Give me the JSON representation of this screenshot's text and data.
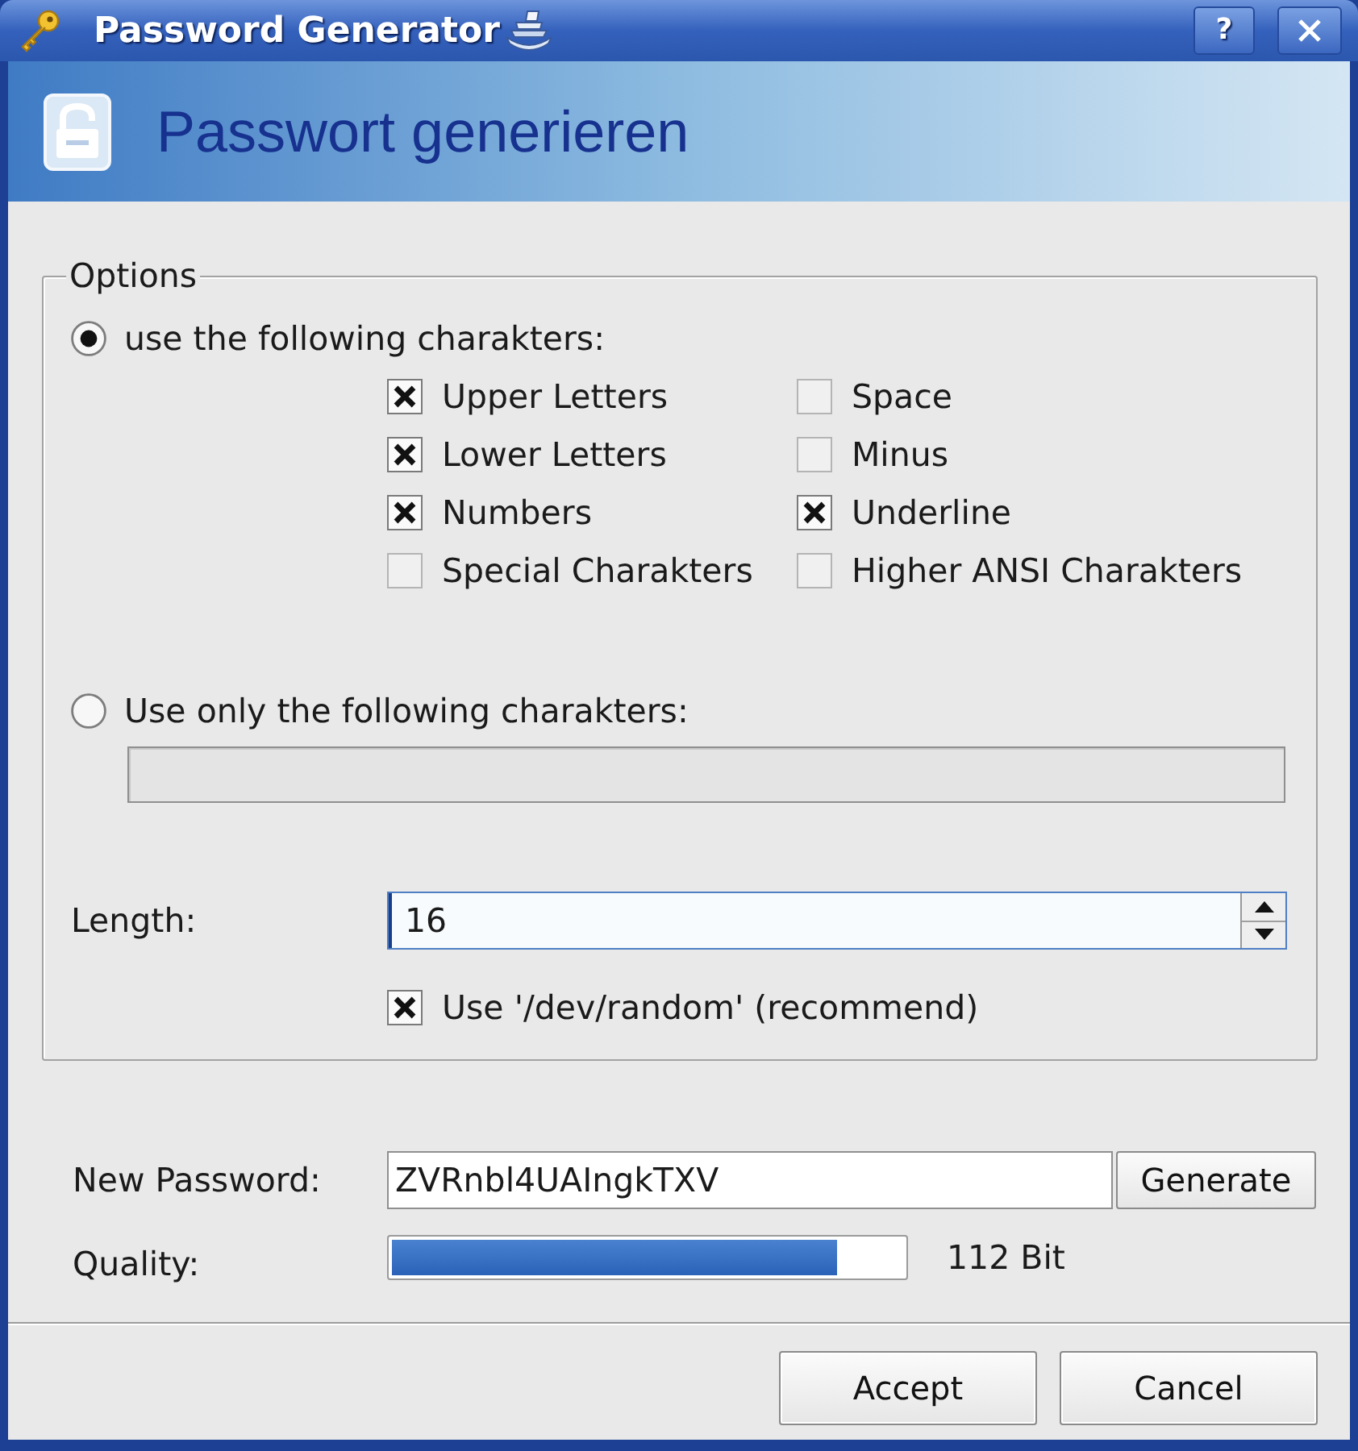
{
  "window": {
    "title": "Password Generator",
    "help_button": "?"
  },
  "header": {
    "title": "Passwort generieren"
  },
  "options": {
    "title": "Options",
    "modes": [
      {
        "label": "use the following charakters:",
        "selected": true
      },
      {
        "label": "Use only the following charakters:",
        "selected": false
      }
    ],
    "charsets": [
      {
        "label": "Upper Letters",
        "checked": true
      },
      {
        "label": "Space",
        "checked": false
      },
      {
        "label": "Lower Letters",
        "checked": true
      },
      {
        "label": "Minus",
        "checked": false
      },
      {
        "label": "Numbers",
        "checked": true
      },
      {
        "label": "Underline",
        "checked": true
      },
      {
        "label": "Special Charakters",
        "checked": false
      },
      {
        "label": "Higher ANSI Charakters",
        "checked": false
      }
    ],
    "custom_field": {
      "disabled": true
    },
    "length": {
      "label": "Length:",
      "value": "16"
    },
    "use_random": {
      "label": "Use '/dev/random' (recommend)",
      "checked": true
    }
  },
  "password": {
    "label": "New Password:",
    "value": "ZVRnbl4UAIngkTXV",
    "button": "Generate"
  },
  "quality": {
    "label": "Quality:",
    "level": 0.87,
    "reading": "112 Bit"
  },
  "buttons": [
    {
      "label": "Accept"
    },
    {
      "label": "Cancel"
    }
  ]
}
